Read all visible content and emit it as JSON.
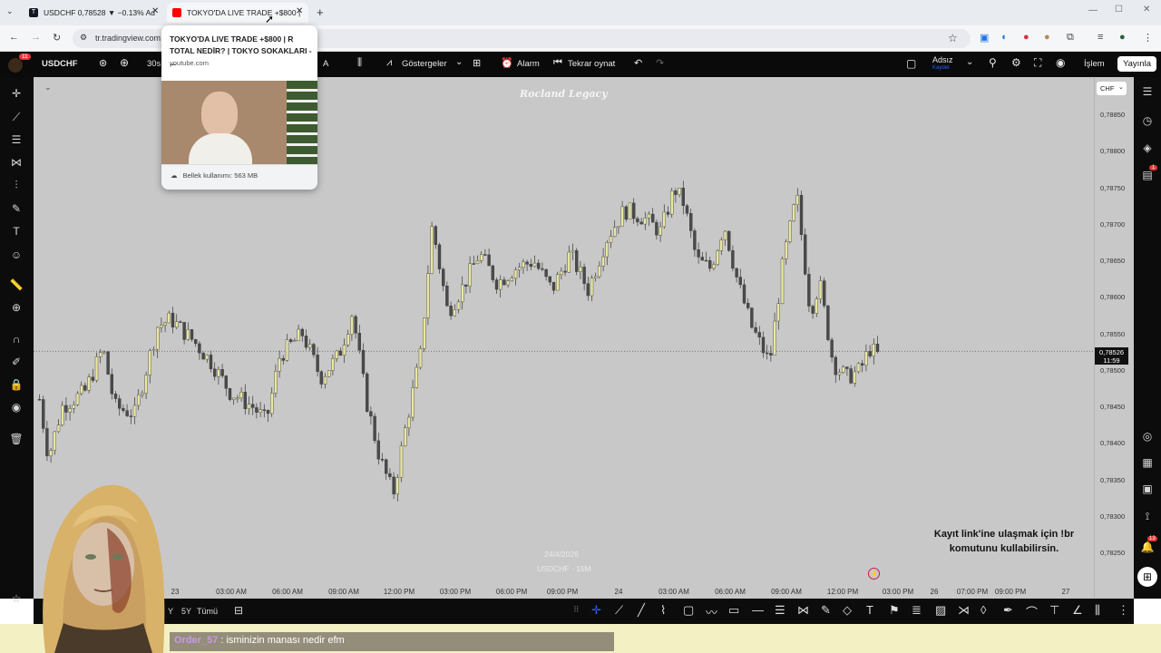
{
  "browser": {
    "tabs": [
      {
        "label": "USDCHF 0,78528 ▼ −0.13% Ad",
        "favicon": "tradingview-icon"
      },
      {
        "label": "TOKYO'DA LIVE TRADE +$800 |",
        "favicon": "youtube-icon"
      }
    ],
    "new_tab": "+",
    "url": "tr.tradingview.com"
  },
  "tooltip": {
    "title": "TOKYO'DA LIVE TRADE +$800 | R TOTAL NEDİR? | TOKYO SOKAKLARI - ...",
    "domain": "youtube.com",
    "memory": "Bellek kullanımı: 563 MB"
  },
  "toolbar": {
    "symbol": "USDCHF",
    "interval": "30s",
    "indicators": "Göstergeler",
    "alarm": "Alarm",
    "replay": "Tekrar oynat",
    "user_name": "Adsız",
    "user_status": "Kaydet",
    "trade": "İşlem",
    "publish": "Yayınla",
    "notif_count": "11",
    "a_label": "A"
  },
  "chart": {
    "watermark": "Rocland Legacy",
    "currency": "CHF",
    "symbol_label": "USDCHF · 15M",
    "date_label": "24/4/2026",
    "price_ticks": [
      "0,78850",
      "0,78800",
      "0,78750",
      "0,78700",
      "0,78650",
      "0,78600",
      "0,78550",
      "0,78500",
      "0,78450",
      "0,78400",
      "0,78350",
      "0,78300",
      "0,78250"
    ],
    "current_price": "0,78526",
    "countdown": "11:59",
    "time_labels": [
      "23",
      "03:00 AM",
      "06:00 AM",
      "09:00 AM",
      "12:00 PM",
      "03:00 PM",
      "06:00 PM",
      "09:00 PM",
      "24",
      "03:00 AM",
      "06:00 AM",
      "09:00 AM",
      "12:00 PM",
      "03:00 PM",
      "26",
      "07:00 PM",
      "09:00 PM",
      "27"
    ],
    "overlay_text_line1": "Kayıt link'ine ulaşmak için !br",
    "overlay_text_line2": "komutunu kullabilirsin.",
    "colors": {
      "bull": "#e8e6a0",
      "bear": "#4a4a4a",
      "background": "#c8c8c8"
    }
  },
  "chart_data": {
    "type": "candlestick",
    "symbol": "USDCHF",
    "timeframe": "15M",
    "ylim": [
      0.7822,
      0.7888
    ],
    "last": 0.78526
  },
  "bottombar": {
    "ranges": [
      "Y",
      "5Y",
      "Tümü"
    ]
  },
  "right_badges": {
    "chat_count": "1",
    "alerts_count": "13"
  },
  "stream_chat": {
    "user": "Order_57",
    "message": ": isminizin manası nedir efm"
  }
}
